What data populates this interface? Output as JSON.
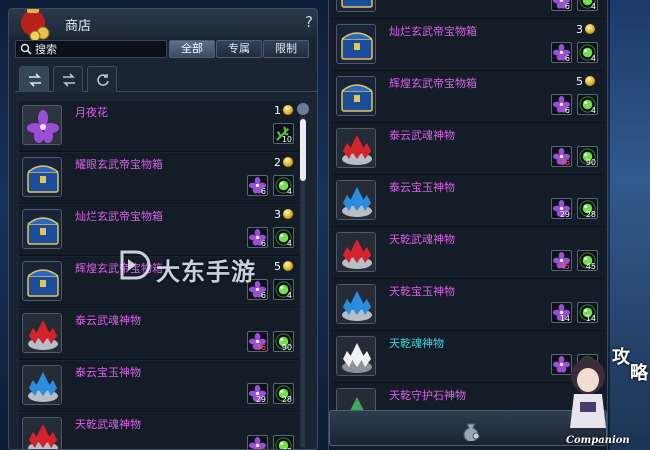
{
  "shop": {
    "title": "商店",
    "help": "?",
    "search": {
      "placeholder": "搜索",
      "value": ""
    },
    "filters": [
      {
        "label": "全部",
        "active": true
      },
      {
        "label": "专属",
        "active": false
      },
      {
        "label": "限制",
        "active": false
      }
    ],
    "tabs": [
      "swap-arrows-icon",
      "swap-arrows-icon",
      "refresh-icon"
    ]
  },
  "left_items": [
    {
      "name": "月夜花",
      "price": "1",
      "thumb": "violet-flower",
      "mats": [
        {
          "icon": "herb-icon",
          "count": "10",
          "red": false
        }
      ]
    },
    {
      "name": "耀眼玄武帝宝物箱",
      "price": "2",
      "thumb": "chest",
      "mats": [
        {
          "icon": "violet-flower-icon",
          "count": "6",
          "red": false
        },
        {
          "icon": "green-orb-icon",
          "count": "4",
          "red": false
        }
      ]
    },
    {
      "name": "灿烂玄武帝宝物箱",
      "price": "3",
      "thumb": "chest",
      "mats": [
        {
          "icon": "violet-flower-icon",
          "count": "6",
          "red": false
        },
        {
          "icon": "green-orb-icon",
          "count": "4",
          "red": false
        }
      ]
    },
    {
      "name": "辉煌玄武帝宝物箱",
      "price": "5",
      "thumb": "chest",
      "mats": [
        {
          "icon": "violet-flower-icon",
          "count": "6",
          "red": false
        },
        {
          "icon": "green-orb-icon",
          "count": "4",
          "red": false
        }
      ]
    },
    {
      "name": "泰云武魂神物",
      "price": "",
      "thumb": "red-crystal",
      "mats": [
        {
          "icon": "violet-flower-icon",
          "count": "36",
          "red": true
        },
        {
          "icon": "green-orb-icon",
          "count": "90",
          "red": false
        }
      ]
    },
    {
      "name": "泰云宝玉神物",
      "price": "",
      "thumb": "blue-crystal",
      "mats": [
        {
          "icon": "violet-flower-icon",
          "count": "29",
          "red": false
        },
        {
          "icon": "green-orb-icon",
          "count": "28",
          "red": false
        }
      ]
    },
    {
      "name": "天乾武魂神物",
      "price": "",
      "thumb": "red-crystal",
      "mats": [
        {
          "icon": "violet-flower-icon",
          "count": "45",
          "red": true
        },
        {
          "icon": "green-orb-icon",
          "count": "45",
          "red": false
        }
      ]
    }
  ],
  "right_items": [
    {
      "name": "",
      "price": "",
      "thumb": "chest",
      "mats": [
        {
          "icon": "violet-flower-icon",
          "count": "6",
          "red": false
        },
        {
          "icon": "green-orb-icon",
          "count": "4",
          "red": false
        }
      ]
    },
    {
      "name": "灿烂玄武帝宝物箱",
      "price": "3",
      "thumb": "chest",
      "mats": [
        {
          "icon": "violet-flower-icon",
          "count": "6",
          "red": false
        },
        {
          "icon": "green-orb-icon",
          "count": "4",
          "red": false
        }
      ]
    },
    {
      "name": "辉煌玄武帝宝物箱",
      "price": "5",
      "thumb": "chest",
      "mats": [
        {
          "icon": "violet-flower-icon",
          "count": "6",
          "red": false
        },
        {
          "icon": "green-orb-icon",
          "count": "4",
          "red": false
        }
      ]
    },
    {
      "name": "泰云武魂神物",
      "price": "",
      "thumb": "red-crystal",
      "mats": [
        {
          "icon": "violet-flower-icon",
          "count": "36",
          "red": true
        },
        {
          "icon": "green-orb-icon",
          "count": "90",
          "red": false
        }
      ]
    },
    {
      "name": "泰云宝玉神物",
      "price": "",
      "thumb": "blue-crystal",
      "mats": [
        {
          "icon": "violet-flower-icon",
          "count": "29",
          "red": false
        },
        {
          "icon": "green-orb-icon",
          "count": "28",
          "red": false
        }
      ]
    },
    {
      "name": "天乾武魂神物",
      "price": "",
      "thumb": "red-crystal",
      "mats": [
        {
          "icon": "violet-flower-icon",
          "count": "45",
          "red": true
        },
        {
          "icon": "green-orb-icon",
          "count": "45",
          "red": false
        }
      ]
    },
    {
      "name": "天乾宝玉神物",
      "price": "",
      "thumb": "blue-crystal",
      "mats": [
        {
          "icon": "violet-flower-icon",
          "count": "14",
          "red": false
        },
        {
          "icon": "green-orb-icon",
          "count": "14",
          "red": false
        }
      ]
    },
    {
      "name": "天乾魂神物",
      "price": "",
      "thumb": "white-crystal",
      "mats": [
        {
          "icon": "violet-flower-icon",
          "count": "",
          "red": false
        },
        {
          "icon": "green-orb-icon",
          "count": "",
          "red": false
        }
      ]
    },
    {
      "name": "天乾守护石神物",
      "price": "",
      "thumb": "green-crystal",
      "mats": []
    }
  ],
  "name_colors": {
    "default": "#d861e6",
    "highlight": "#3fd7e0"
  },
  "watermark": {
    "text": "大东手游"
  },
  "companion": {
    "label": "Companion",
    "glyph1": "攻",
    "glyph2": "略"
  }
}
